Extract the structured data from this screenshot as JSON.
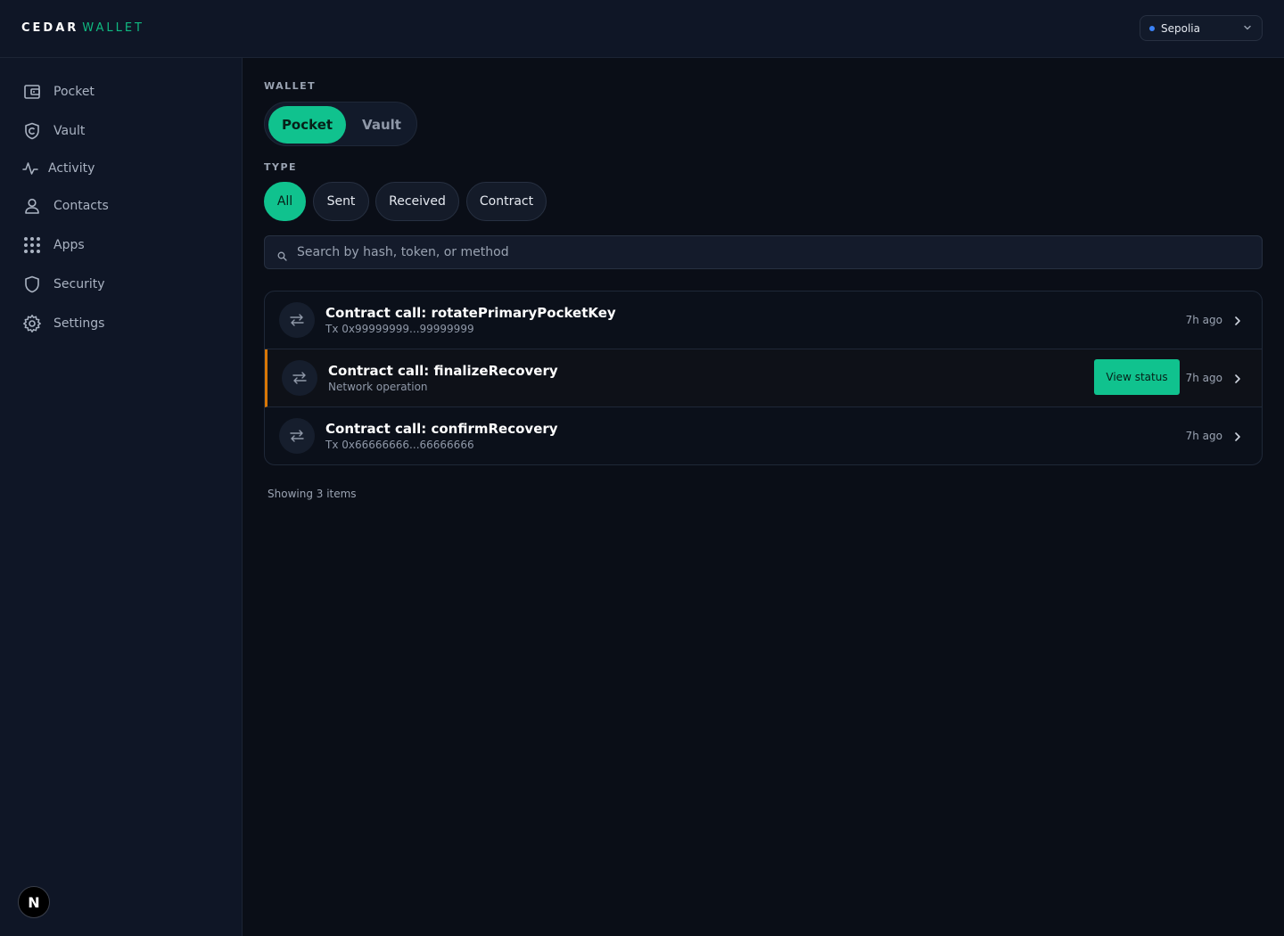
{
  "brand": {
    "primary": "CEDAR",
    "secondary": "WALLET"
  },
  "network": {
    "selected": "Sepolia",
    "status_color": "#3b82f6"
  },
  "sidebar": {
    "items": [
      {
        "label": "Pocket",
        "icon": "wallet-icon"
      },
      {
        "label": "Vault",
        "icon": "shield-lock-icon"
      },
      {
        "label": "Activity",
        "icon": "activity-icon"
      },
      {
        "label": "Contacts",
        "icon": "user-icon"
      },
      {
        "label": "Apps",
        "icon": "grid-icon"
      },
      {
        "label": "Security",
        "icon": "shield-icon"
      },
      {
        "label": "Settings",
        "icon": "gear-icon"
      }
    ],
    "avatar": "N"
  },
  "filters": {
    "wallet_label": "WALLET",
    "wallet_options": [
      "Pocket",
      "Vault"
    ],
    "wallet_selected": "Pocket",
    "type_label": "TYPE",
    "type_options": [
      "All",
      "Sent",
      "Received",
      "Contract"
    ],
    "type_selected": "All"
  },
  "search": {
    "value": "",
    "placeholder": "Search by hash, token, or method"
  },
  "transactions": [
    {
      "title": "Contract call: rotatePrimaryPocketKey",
      "subtitle": "Tx 0x99999999...99999999",
      "time": "7h ago",
      "pending": false
    },
    {
      "title": "Contract call: finalizeRecovery",
      "subtitle": "Network operation",
      "time": "7h ago",
      "pending": true,
      "action": "View status"
    },
    {
      "title": "Contract call: confirmRecovery",
      "subtitle": "Tx 0x66666666...66666666",
      "time": "7h ago",
      "pending": false
    }
  ],
  "footer": {
    "showing": "Showing 3 items"
  },
  "colors": {
    "accent": "#10c28e",
    "pending": "#d97706",
    "background": "#0a0e17",
    "panel": "#0f1626"
  }
}
